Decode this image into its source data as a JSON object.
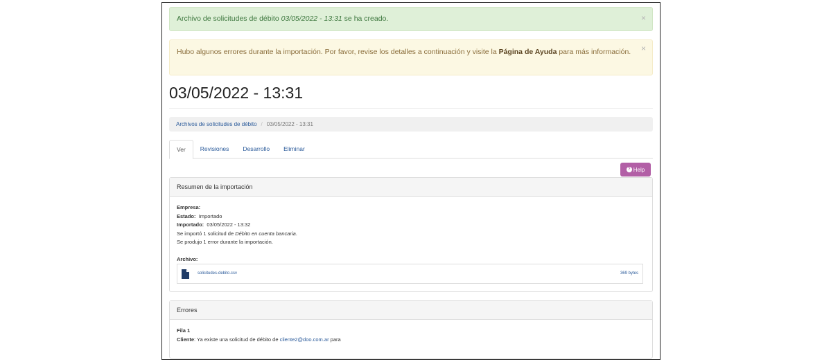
{
  "alerts": {
    "success": {
      "prefix": "Archivo de solicitudes de débito ",
      "date": "03/05/2022 - 13:31",
      "suffix": " se ha creado.",
      "close": "×"
    },
    "warning": {
      "prefix": "Hubo algunos errores durante la importación. Por favor, revise los detalles a continuación y visite la ",
      "link": "Página de Ayuda",
      "suffix": " para más información.",
      "close": "×"
    }
  },
  "page": {
    "title": "03/05/2022 - 13:31"
  },
  "breadcrumb": {
    "parent": "Archivos de solicitudes de débito",
    "separator": "/",
    "current": "03/05/2022 - 13:31"
  },
  "tabs": [
    "Ver",
    "Revisiones",
    "Desarrollo",
    "Eliminar"
  ],
  "help_button": {
    "icon": "question-circle-icon",
    "label": "Help",
    "color": "#b25fa6"
  },
  "import_summary": {
    "heading": "Resumen de la importación",
    "empresa_label": "Empresa:",
    "estado_label": "Estado:",
    "estado_value": "Importado",
    "importado_label": "Importado:",
    "importado_value": "03/05/2022 - 13:32",
    "imported_prefix": "Se importó 1 solicitud de ",
    "imported_type": "Débito en cuenta bancaria",
    "imported_suffix": ".",
    "errors_line": "Se produjo 1 error durante la importación.",
    "archivo_label": "Archivo:",
    "file": {
      "icon": "file-icon",
      "name": "solicitudes-debito.csv",
      "size": "369 bytes"
    }
  },
  "errors_panel": {
    "heading": "Errores",
    "row_label": "Fila 1",
    "cliente_label": "Cliente",
    "message_prefix": ": Ya existe una solicitud de débito de ",
    "email": "cliente2@doo.com.ar",
    "message_suffix": " para"
  }
}
